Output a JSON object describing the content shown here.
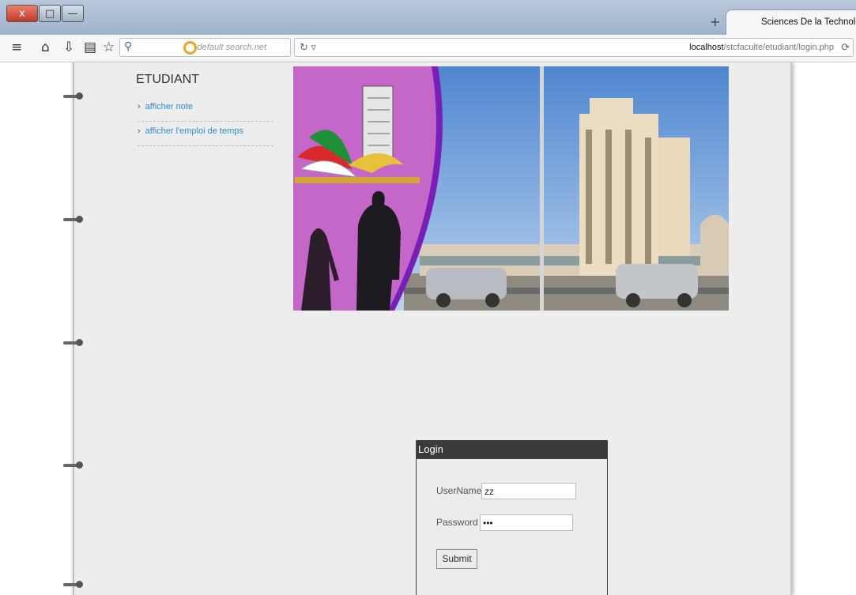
{
  "browser": {
    "tab_title": "Sciences De la Technologie",
    "search_placeholder": "default search.net",
    "url_host": "localhost",
    "url_path": "/stcfaculte/etudiant/login.php",
    "window_buttons": [
      "x",
      "□",
      "—"
    ],
    "new_tab_symbol": "+"
  },
  "sidebar": {
    "title": "ETUDIANT",
    "links": [
      {
        "label": "afficher note"
      },
      {
        "label": "afficher l'emploi de temps"
      }
    ]
  },
  "login": {
    "heading": "Login",
    "username_label": "UserName :",
    "username_value": "zz",
    "password_label": "Password :",
    "password_value": "•••",
    "submit_label": "Submit"
  }
}
